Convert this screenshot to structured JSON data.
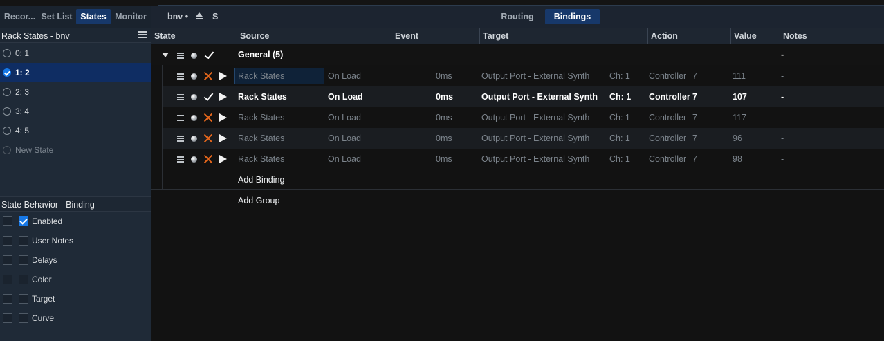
{
  "sidebar": {
    "tabs": [
      {
        "label": "Recor...",
        "active": false
      },
      {
        "label": "Set List",
        "active": false
      },
      {
        "label": "States",
        "active": true
      },
      {
        "label": "Monitor",
        "active": false
      }
    ],
    "rack_states_title": "Rack States - bnv",
    "states": [
      {
        "label": "0: 1",
        "selected": false
      },
      {
        "label": "1: 2",
        "selected": true
      },
      {
        "label": "2: 3",
        "selected": false
      },
      {
        "label": "3: 4",
        "selected": false
      },
      {
        "label": "4: 5",
        "selected": false
      },
      {
        "label": "New State",
        "selected": false
      }
    ],
    "behavior_title": "State Behavior - Binding",
    "behaviors": [
      {
        "label": "Enabled",
        "outer_checked": false,
        "inner_checked": true
      },
      {
        "label": "User Notes",
        "outer_checked": false,
        "inner_checked": false
      },
      {
        "label": "Delays",
        "outer_checked": false,
        "inner_checked": false
      },
      {
        "label": "Color",
        "outer_checked": false,
        "inner_checked": false
      },
      {
        "label": "Target",
        "outer_checked": false,
        "inner_checked": false
      },
      {
        "label": "Curve",
        "outer_checked": false,
        "inner_checked": false
      }
    ]
  },
  "toolbar": {
    "rack_name": "bnv •",
    "s_label": "S",
    "view_tabs": [
      {
        "label": "Routing",
        "active": false
      },
      {
        "label": "Bindings",
        "active": true
      }
    ]
  },
  "columns": [
    "State",
    "Source",
    "Event",
    "Target",
    "Action",
    "Value",
    "Notes"
  ],
  "group": {
    "name": "General (5)",
    "notes": "-"
  },
  "bindings": [
    {
      "state_icon": "x",
      "source": "Rack States",
      "event": "On Load",
      "delay": "0ms",
      "target": "Output Port - External Synth",
      "channel": "Ch: 1",
      "action": "Controller",
      "action_num": "7",
      "value": "111",
      "notes": "-",
      "active": false,
      "source_focused": true
    },
    {
      "state_icon": "check",
      "source": "Rack States",
      "event": "On Load",
      "delay": "0ms",
      "target": "Output Port - External Synth",
      "channel": "Ch: 1",
      "action": "Controller",
      "action_num": "7",
      "value": "107",
      "notes": "-",
      "active": true,
      "source_focused": false
    },
    {
      "state_icon": "x",
      "source": "Rack States",
      "event": "On Load",
      "delay": "0ms",
      "target": "Output Port - External Synth",
      "channel": "Ch: 1",
      "action": "Controller",
      "action_num": "7",
      "value": "117",
      "notes": "-",
      "active": false,
      "source_focused": false
    },
    {
      "state_icon": "x",
      "source": "Rack States",
      "event": "On Load",
      "delay": "0ms",
      "target": "Output Port - External Synth",
      "channel": "Ch: 1",
      "action": "Controller",
      "action_num": "7",
      "value": "96",
      "notes": "-",
      "active": false,
      "source_focused": false
    },
    {
      "state_icon": "x",
      "source": "Rack States",
      "event": "On Load",
      "delay": "0ms",
      "target": "Output Port - External Synth",
      "channel": "Ch: 1",
      "action": "Controller",
      "action_num": "7",
      "value": "98",
      "notes": "-",
      "active": false,
      "source_focused": false
    }
  ],
  "add_binding_label": "Add Binding",
  "add_group_label": "Add Group",
  "colors": {
    "accent": "#17386a",
    "selected_row": "#0f2d63",
    "x_mark": "#e8681c",
    "checkbox": "#1778e6"
  }
}
